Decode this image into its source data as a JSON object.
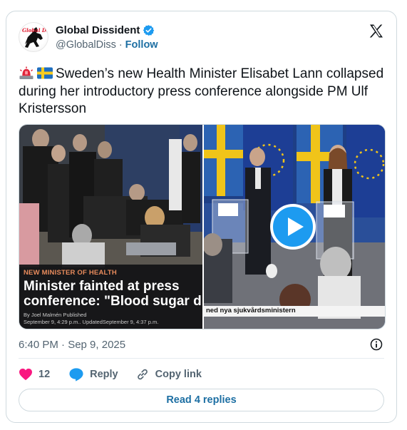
{
  "author": {
    "display_name": "Global Dissident",
    "handle": "@GlobalDiss",
    "separator": "·",
    "follow_label": "Follow",
    "verified_color": "#1d9bf0",
    "avatar_icon": "horse-logo-icon",
    "avatar_text": "Global Dissident"
  },
  "tweet": {
    "emojis": [
      "police-light-icon",
      "sweden-flag-icon"
    ],
    "text": "Sweden’s new Health Minister Elisabet Lann collapsed during her introductory press conference alongside PM Ulf Kristersson"
  },
  "media": {
    "left_caption": {
      "kicker": "NEW MINISTER OF HEALTH",
      "headline": "Minister fainted at press\nconference: \"Blood sugar dro",
      "byline_line1": "By Joel Malmén Published",
      "byline_line2": "September 9, 4:29 p.m.. UpdatedSeptember 9, 4:37 p.m."
    },
    "right_lower_third": "ned nya sjukvårdsministern",
    "play_icon": "play-icon"
  },
  "meta": {
    "timestamp": "6:40 PM · Sep 9, 2025",
    "info_icon": "info-icon"
  },
  "actions": {
    "like_count": "12",
    "reply_label": "Reply",
    "copy_link_label": "Copy link",
    "like_color": "#f91880",
    "reply_color": "#1d9bf0"
  },
  "read_replies_label": "Read 4 replies",
  "colors": {
    "accent": "#1d9bf0",
    "link": "#1d6fa3",
    "text": "#0f1419",
    "muted": "#536471"
  }
}
